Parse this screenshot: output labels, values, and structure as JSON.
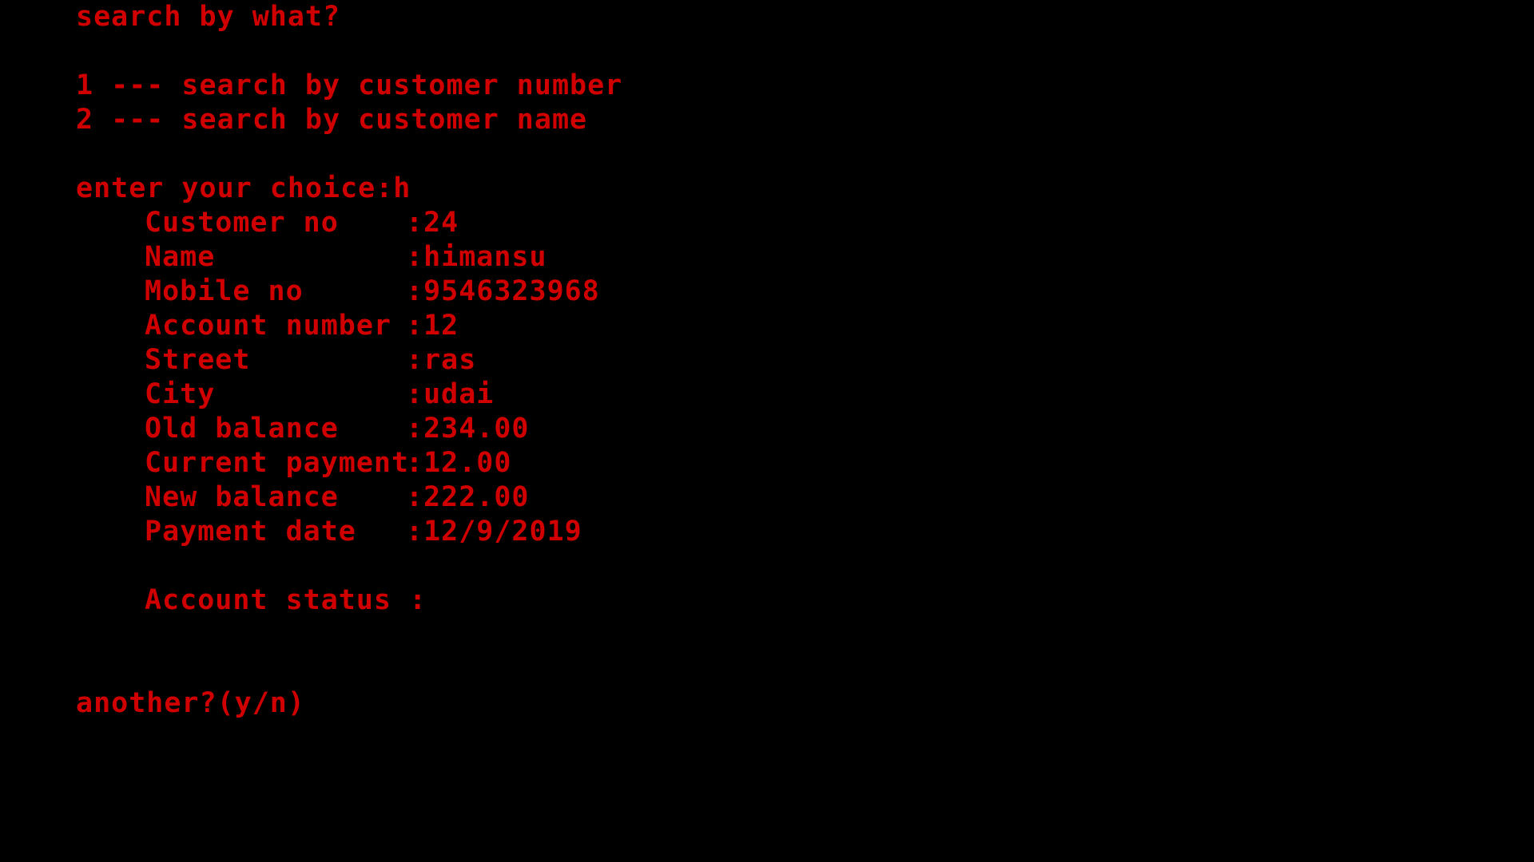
{
  "terminal": {
    "prompt_title": "search by what?",
    "options": [
      "1 --- search by customer number",
      "2 --- search by customer name"
    ],
    "choice_prompt": "enter your choice:",
    "choice_value": "h",
    "fields": [
      {
        "label": "Customer no",
        "value": "24"
      },
      {
        "label": "Name",
        "value": "himansu"
      },
      {
        "label": "Mobile no",
        "value": "9546323968"
      },
      {
        "label": "Account number",
        "value": "12"
      },
      {
        "label": "Street",
        "value": "ras"
      },
      {
        "label": "City",
        "value": "udai"
      },
      {
        "label": "Old balance",
        "value": "234.00"
      },
      {
        "label": "Current payment",
        "value": "12.00"
      },
      {
        "label": "New balance",
        "value": "222.00"
      },
      {
        "label": "Payment date",
        "value": "12/9/2019"
      }
    ],
    "separator": ":",
    "account_status_label": "Account status",
    "account_status_sep": " :",
    "another_prompt": "another?(y/n)",
    "colors": {
      "background": "#000000",
      "text": "#d10000"
    }
  }
}
